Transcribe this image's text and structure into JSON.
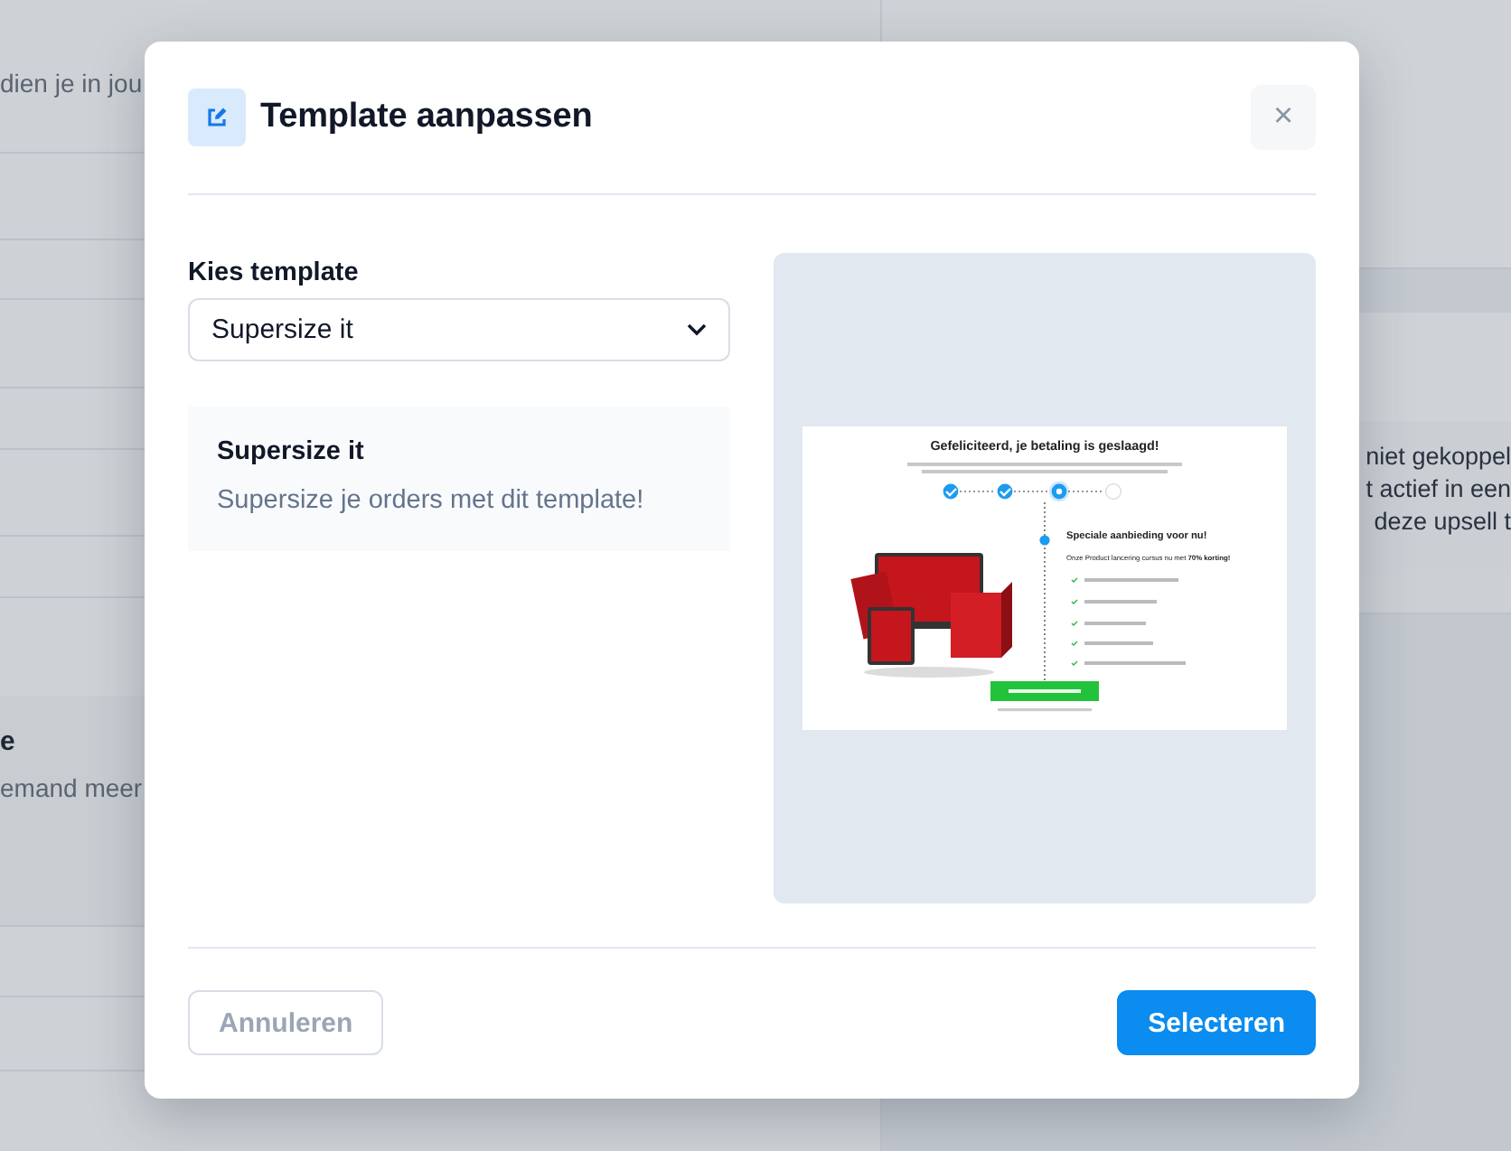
{
  "background": {
    "intro_fragment": "dien je in jou",
    "section_title_fragment": "e",
    "section_text_fragment": "emand meer",
    "notice_lines": [
      "niet gekoppel",
      "t actief in een",
      "deze upsell t"
    ]
  },
  "dialog": {
    "title": "Template aanpassen",
    "close_label": "×",
    "field_label": "Kies template",
    "select_value": "Supersize it",
    "template": {
      "name": "Supersize it",
      "description": "Supersize je orders met dit template!"
    },
    "preview": {
      "heading": "Gefeliciteerd, je betaling is geslaagd!",
      "steps": [
        {
          "completed": true,
          "current": false
        },
        {
          "completed": true,
          "current": false
        },
        {
          "completed": false,
          "current": true
        },
        {
          "completed": false,
          "current": false
        }
      ],
      "offer_title": "Speciale aanbieding voor nu!",
      "offer_subtitle": "Onze Product lancering cursus nu met **70% korting!**"
    },
    "buttons": [
      {
        "label": "Annuleren",
        "kind": "secondary"
      },
      {
        "label": "Selecteren",
        "kind": "primary"
      }
    ]
  }
}
